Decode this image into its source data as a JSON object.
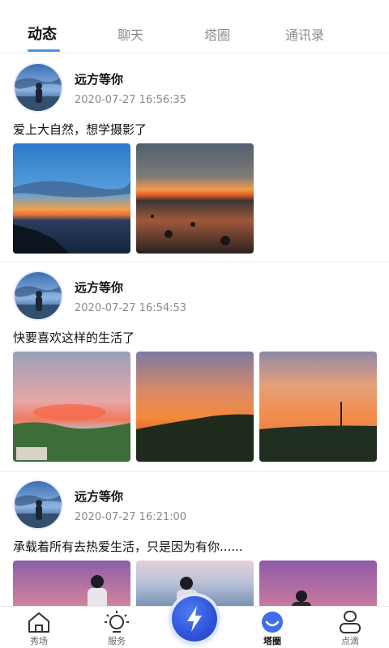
{
  "tabs": [
    {
      "label": "动态",
      "active": true
    },
    {
      "label": "聊天",
      "active": false
    },
    {
      "label": "塔圈",
      "active": false
    },
    {
      "label": "通讯录",
      "active": false
    }
  ],
  "posts": [
    {
      "user": "远方等你",
      "time": "2020-07-27 16:56:35",
      "text": "爱上大自然，想学摄影了",
      "photo_count": 2
    },
    {
      "user": "远方等你",
      "time": "2020-07-27 16:54:53",
      "text": "快要喜欢这样的生活了",
      "photo_count": 3
    },
    {
      "user": "远方等你",
      "time": "2020-07-27 16:21:00",
      "text": "承载着所有去热爱生活，只是因为有你......",
      "photo_count": 3
    }
  ],
  "nav": [
    {
      "label": "秀场",
      "icon": "home-icon"
    },
    {
      "label": "服务",
      "icon": "lightbulb-icon"
    },
    {
      "label": "",
      "icon": "lightning-icon"
    },
    {
      "label": "塔圈",
      "icon": "circle-smile-icon",
      "active": true
    },
    {
      "label": "点滴",
      "icon": "user-icon"
    }
  ],
  "colors": {
    "accent": "#4a90e2",
    "center_button": "#2f53d8"
  }
}
